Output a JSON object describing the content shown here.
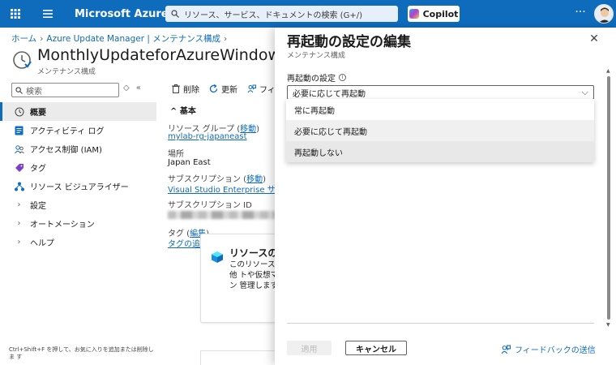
{
  "topbar": {
    "brand": "Microsoft Azure",
    "search_placeholder": "リソース、サービス、ドキュメントの検索 (G+/)",
    "copilot_label": "Copilot",
    "more_label": "···"
  },
  "breadcrumb": {
    "home": "ホーム",
    "parent": "Azure Update Manager | メンテナンス構成"
  },
  "resource": {
    "title": "MonthlyUpdateforAzureWindowsVM",
    "subtitle": "メンテナンス構成"
  },
  "sidebar": {
    "search_placeholder": "検索",
    "items": [
      {
        "label": "概要",
        "icon": "clock-icon",
        "active": true
      },
      {
        "label": "アクティビティ ログ",
        "icon": "log-icon"
      },
      {
        "label": "アクセス制御 (IAM)",
        "icon": "people-icon"
      },
      {
        "label": "タグ",
        "icon": "tag-icon"
      },
      {
        "label": "リソース ビジュアライザー",
        "icon": "visualizer-icon"
      },
      {
        "label": "設定",
        "icon": "chevron-right-icon"
      },
      {
        "label": "オートメーション",
        "icon": "chevron-right-icon"
      },
      {
        "label": "ヘルプ",
        "icon": "chevron-right-icon"
      }
    ],
    "hint": "Ctrl+Shift+F を押して、お気に入りを追加または削除しま す"
  },
  "commands": {
    "delete": "削除",
    "refresh": "更新",
    "feedback": "フィー"
  },
  "essentials": {
    "header": "基本",
    "rg_label": "リソース グループ (",
    "rg_move": "移動",
    "rg_close": ")",
    "rg_value": "mylab-rg-japaneast",
    "location_label": "場所",
    "location_value": "Japan East",
    "sub_label": "サブスクリプション (",
    "sub_move": "移動",
    "sub_close": ")",
    "sub_value": "Visual Studio Enterprise サブス",
    "subid_label": "サブスクリプション ID",
    "tags_label": "タグ (",
    "tags_edit": "編集",
    "tags_close": ")",
    "tags_add": "タグの追加"
  },
  "card": {
    "title": "リソースの管",
    "desc": "このリソースと他 トや仮想マシン 管理します。"
  },
  "panel": {
    "title": "再起動の設定の編集",
    "subtitle": "メンテナンス構成",
    "field_label": "再起動の設定",
    "selected_value": "必要に応じて再起動",
    "options": [
      "常に再起動",
      "必要に応じて再起動",
      "再起動しない"
    ],
    "apply_label": "適用",
    "cancel_label": "キャンセル",
    "feedback_label": "フィードバックの送信"
  },
  "colors": {
    "accent": "#0f6cbd",
    "topbar": "#0f6cbd"
  }
}
